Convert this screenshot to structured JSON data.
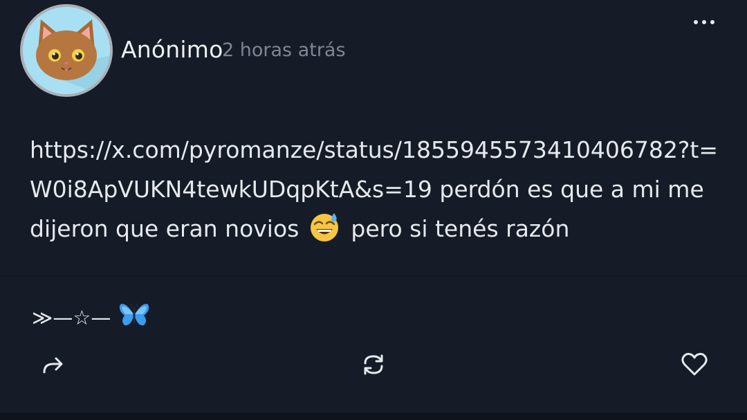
{
  "post": {
    "author": "Anónimo",
    "time": "2 horas atrás",
    "text_main": "https://x.com/pyromanze/status/1855945573410406782?t=W0i8ApVUKN4tewkUDqpKtA&s=19 perdón es que a mi me dijeron que eran novios",
    "text_after_emoji": "pero si tenés razón",
    "emoji": "sweat-smile-emoji",
    "signature": "≫—☆—",
    "signature_emoji": "butterfly-emoji"
  },
  "icons": {
    "more": "more-horizontal-icon",
    "share": "share-forward-icon",
    "repost": "repost-icon",
    "like": "heart-icon"
  },
  "colors": {
    "background": "#161c27",
    "text": "#e6e9ee",
    "muted": "#7d8794",
    "avatar_bg": "#a9dff2"
  }
}
